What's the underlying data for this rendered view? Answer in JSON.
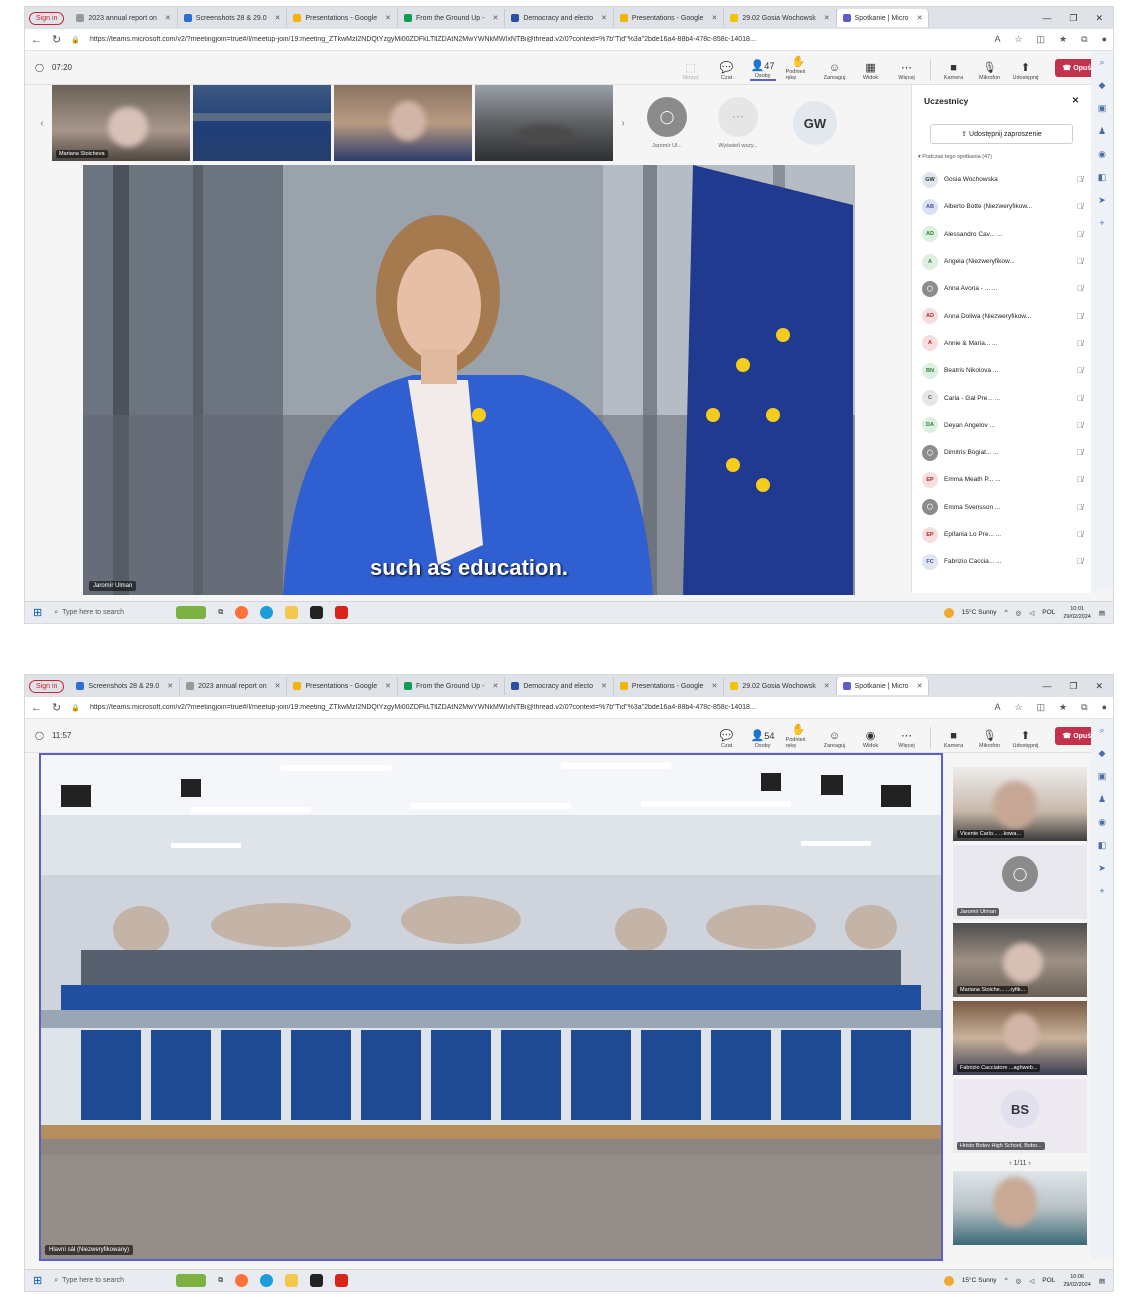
{
  "browser": {
    "signin_label": "Sign in",
    "tabs_top": [
      "",
      "",
      "2023 annual report on",
      "Screenshots 28 & 29.0",
      "Presentations - Google",
      "From the Ground Up -",
      "Democracy and electo",
      "Presentations - Google",
      "29.02 Gosia Wochowsk",
      "Spotkanie | Micro"
    ],
    "tabs_bottom": [
      "Screenshots 28 & 29.0",
      "2023 annual report on",
      "Presentations - Google",
      "From the Ground Up -",
      "Democracy and electo",
      "Presentations - Google",
      "29.02 Gosia Wochowsk",
      "Spotkanie | Micro"
    ],
    "url_top": "https://teams.microsoft.com/v2/?meetingjoin=true#/l/meetup-join/19:meeting_ZTkwMzI2NDQtYzgyMi00ZDFkLTllZDAtN2MwYWNkMWIxNTBi@thread.v2/0?context=%7b\"Tid\"%3a\"2bde16a4-88b4-478c-858c-14018...",
    "url_bottom": "https://teams.microsoft.com/v2/?meetingjoin=true#/l/meetup-join/19:meeting_ZTkwMzI2NDQtYzgyMi00ZDFkLTllZDAtN2MwYWNkMWIxNTBi@thread.v2/0?context=%7b\"Tid\"%3a\"2bde16a4-88b4-478c-858c-14018..."
  },
  "meeting1": {
    "timer": "07:20",
    "people_count": "47",
    "controls": {
      "share": "Skrzyż",
      "chat": "Czat",
      "people": "Osoby",
      "raise_hand": "Podnieś rękę",
      "react": "Zareaguj",
      "view": "Widok",
      "more": "Więcej",
      "camera": "Kamera",
      "mic": "Mikrofon",
      "share_screen": "Udostępnij",
      "leave": "Opuść"
    },
    "filmstrip": [
      {
        "name": "Mariana Stoicheva"
      },
      {
        "name": ""
      },
      {
        "name": ""
      },
      {
        "name": ""
      }
    ],
    "avatar_tiles": [
      {
        "name": "Jaromír Ul..."
      },
      {
        "name": "Wyświetl wszy..."
      }
    ],
    "gw_initials": "GW",
    "caption": "such as education.",
    "video_name": "Jaromír Ulman",
    "panel": {
      "title": "Uczestnicy",
      "share_invite": "Udostępnij zaproszenie",
      "group_label": "Podczas tego spotkania (47)",
      "participants": [
        {
          "initials": "GW",
          "name": "Gosia Wochowska",
          "color": "#dfe6ef",
          "fg": "#333"
        },
        {
          "initials": "AB",
          "name": "Alberto Botte (Niezweryfikow...",
          "color": "#dbe1f5",
          "fg": "#4650a8"
        },
        {
          "initials": "AD",
          "name": "Alessandro Cav... ...",
          "color": "#dcefe0",
          "fg": "#2e7d32"
        },
        {
          "initials": "A",
          "name": "Angela (Niezweryfikow...",
          "color": "#dcefe0",
          "fg": "#2e7d32"
        },
        {
          "initials": "",
          "name": "Anna Avona - ... ...",
          "color": "#8c8c8c",
          "fg": "#fff"
        },
        {
          "initials": "AD",
          "name": "Anna Doliwa (Niezweryfikow...",
          "color": "#f6dede",
          "fg": "#b22a2a"
        },
        {
          "initials": "A",
          "name": "Annie & Maria... ...",
          "color": "#f6dede",
          "fg": "#b22a2a"
        },
        {
          "initials": "BN",
          "name": "Beatris Nikolova ...",
          "color": "#dcefe0",
          "fg": "#2e7d32"
        },
        {
          "initials": "C",
          "name": "Carla - Gal Pre... ...",
          "color": "#e6e6e6",
          "fg": "#555"
        },
        {
          "initials": "DA",
          "name": "Deyan Angelov ...",
          "color": "#dcefe0",
          "fg": "#2e7d32"
        },
        {
          "initials": "",
          "name": "Dimitris Bogiat... ...",
          "color": "#8c8c8c",
          "fg": "#fff"
        },
        {
          "initials": "EP",
          "name": "Emma Meath P... ...",
          "color": "#f6dede",
          "fg": "#b22a2a"
        },
        {
          "initials": "",
          "name": "Emma Svensson ...",
          "color": "#8c8c8c",
          "fg": "#fff"
        },
        {
          "initials": "EP",
          "name": "Epifania Lo Pre... ...",
          "color": "#f6dede",
          "fg": "#b22a2a"
        },
        {
          "initials": "FC",
          "name": "Fabrizio Caccia... ...",
          "color": "#dfe6ef",
          "fg": "#4650a8"
        }
      ]
    }
  },
  "meeting2": {
    "timer": "11:57",
    "people_count": "54",
    "stage_name": "Hlavní sál (Niezweryfikowany)",
    "right_tiles": [
      {
        "name": "Vicente Carlo... ...kowa..."
      },
      {
        "name": "Jaromír Ulman"
      },
      {
        "name": "Mariana Stoiche... ...ryfik..."
      },
      {
        "name": "Fabrizio Cacciatore ...aghweb..."
      },
      {
        "name": "Hristo Botev High School, Bobo..."
      }
    ],
    "bs_initials": "BS",
    "pager": "1/11"
  },
  "taskbar": {
    "search_placeholder": "Type here to search",
    "weather": "15°C  Sunny",
    "lang": "POL",
    "time_top": "10:01",
    "date_top": "29/02/2024",
    "time_bottom": "10:06",
    "date_bottom": "29/02/2024"
  }
}
